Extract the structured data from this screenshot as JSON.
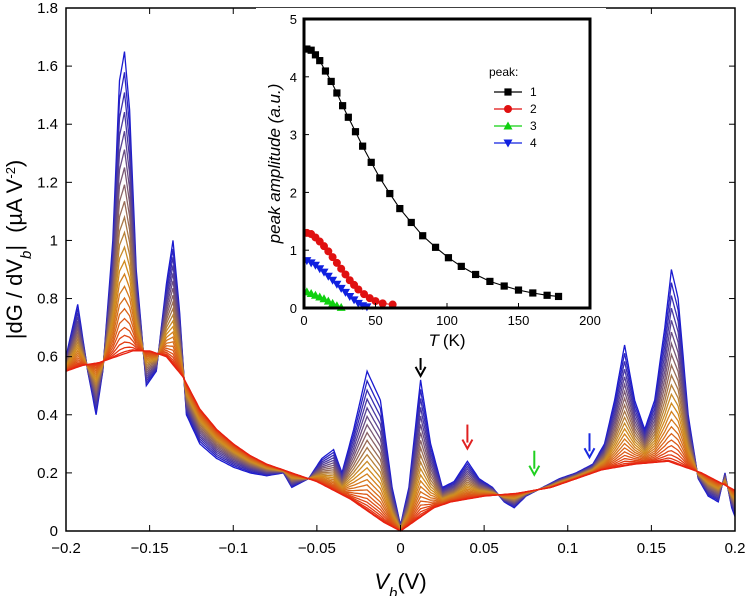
{
  "chart_data": [
    {
      "type": "line",
      "title": "",
      "xlabel": "V_b (V)",
      "ylabel": "|dG / dV_b|   (µA V^-2)",
      "xlabel_parts": {
        "symbol": "V",
        "sub": "b",
        "unit": "(V)"
      },
      "ylabel_parts": {
        "prefix": "|dG / dV",
        "sub": "b",
        "suffix": "|",
        "unit_open": "(µA V",
        "unit_sup": "-2",
        "unit_close": ")"
      },
      "xlim": [
        -0.2,
        0.2
      ],
      "ylim": [
        0,
        1.8
      ],
      "xticks": [
        -0.2,
        -0.15,
        -0.1,
        -0.05,
        0,
        0.05,
        0.1,
        0.15,
        0.2
      ],
      "xtick_labels": [
        "−0.2",
        "−0.15",
        "−0.1",
        "−0.05",
        "0",
        "0.05",
        "0.1",
        "0.15",
        "0.2"
      ],
      "yticks": [
        0,
        0.2,
        0.4,
        0.6,
        0.8,
        1,
        1.2,
        1.4,
        1.6,
        1.8
      ],
      "ytick_labels": [
        "0",
        "0.2",
        "0.4",
        "0.6",
        "0.8",
        "1",
        "1.2",
        "1.4",
        "1.6",
        "1.8"
      ],
      "grid": false,
      "series_note_colors": [
        "#1a1ad0",
        "#d09020",
        "#e82010"
      ],
      "n_curves": 24,
      "series": [
        {
          "temperature_order": "lowest",
          "x": [
            -0.2,
            -0.193,
            -0.187,
            -0.182,
            -0.178,
            -0.172,
            -0.168,
            -0.165,
            -0.162,
            -0.158,
            -0.152,
            -0.146,
            -0.14,
            -0.136,
            -0.132,
            -0.128,
            -0.12,
            -0.11,
            -0.1,
            -0.09,
            -0.08,
            -0.07,
            -0.065,
            -0.055,
            -0.047,
            -0.04,
            -0.035,
            -0.028,
            -0.02,
            -0.012,
            -0.005,
            0,
            0.005,
            0.012,
            0.018,
            0.025,
            0.032,
            0.04,
            0.047,
            0.055,
            0.062,
            0.068,
            0.075,
            0.085,
            0.095,
            0.105,
            0.115,
            0.122,
            0.128,
            0.134,
            0.14,
            0.146,
            0.152,
            0.158,
            0.162,
            0.166,
            0.172,
            0.178,
            0.184,
            0.19,
            0.194,
            0.198,
            0.2
          ],
          "y": [
            0.6,
            0.78,
            0.55,
            0.4,
            0.55,
            1.0,
            1.55,
            1.65,
            1.45,
            0.9,
            0.5,
            0.55,
            0.85,
            1.0,
            0.75,
            0.4,
            0.3,
            0.25,
            0.22,
            0.2,
            0.19,
            0.2,
            0.15,
            0.18,
            0.25,
            0.28,
            0.2,
            0.35,
            0.55,
            0.45,
            0.15,
            0.02,
            0.15,
            0.52,
            0.3,
            0.15,
            0.17,
            0.24,
            0.18,
            0.15,
            0.1,
            0.08,
            0.12,
            0.15,
            0.18,
            0.2,
            0.23,
            0.3,
            0.45,
            0.64,
            0.45,
            0.35,
            0.45,
            0.7,
            0.9,
            0.8,
            0.4,
            0.18,
            0.12,
            0.1,
            0.2,
            0.08,
            0.05
          ]
        },
        {
          "temperature_order": "highest",
          "x": [
            -0.2,
            -0.19,
            -0.18,
            -0.17,
            -0.16,
            -0.15,
            -0.14,
            -0.13,
            -0.12,
            -0.11,
            -0.1,
            -0.09,
            -0.08,
            -0.07,
            -0.06,
            -0.05,
            -0.04,
            -0.03,
            -0.02,
            -0.01,
            0,
            0.01,
            0.02,
            0.03,
            0.04,
            0.05,
            0.06,
            0.07,
            0.08,
            0.09,
            0.1,
            0.11,
            0.12,
            0.13,
            0.14,
            0.15,
            0.16,
            0.17,
            0.18,
            0.19,
            0.2
          ],
          "y": [
            0.55,
            0.57,
            0.58,
            0.6,
            0.62,
            0.62,
            0.6,
            0.53,
            0.42,
            0.35,
            0.3,
            0.26,
            0.23,
            0.21,
            0.19,
            0.17,
            0.14,
            0.11,
            0.07,
            0.03,
            0.0,
            0.04,
            0.08,
            0.1,
            0.11,
            0.12,
            0.125,
            0.13,
            0.14,
            0.15,
            0.17,
            0.19,
            0.21,
            0.22,
            0.23,
            0.235,
            0.24,
            0.22,
            0.2,
            0.17,
            0.14
          ]
        }
      ],
      "annotations": [
        {
          "type": "arrow",
          "x": 0.012,
          "y_tip": 0.52,
          "color": "#000000"
        },
        {
          "type": "arrow",
          "x": 0.04,
          "y_tip": 0.27,
          "color": "#e02020"
        },
        {
          "type": "arrow",
          "x": 0.08,
          "y_tip": 0.18,
          "color": "#20d020"
        },
        {
          "type": "arrow",
          "x": 0.113,
          "y_tip": 0.24,
          "color": "#1a2ae0"
        }
      ]
    },
    {
      "type": "line",
      "title": "",
      "xlabel": "T (K)",
      "ylabel": "peak amplitude (a.u.)",
      "xlabel_parts": {
        "symbol": "T",
        "unit": "(K)"
      },
      "xlim": [
        0,
        200
      ],
      "ylim": [
        0,
        5
      ],
      "xticks": [
        0,
        50,
        100,
        150,
        200
      ],
      "xtick_labels": [
        "0",
        "50",
        "100",
        "150",
        "200"
      ],
      "yticks": [
        0,
        1,
        2,
        3,
        4,
        5
      ],
      "ytick_labels": [
        "0",
        "1",
        "2",
        "3",
        "4",
        "5"
      ],
      "grid": false,
      "legend_title": "peak:",
      "legend_position": "top-right",
      "series": [
        {
          "name": "1",
          "color": "#000000",
          "marker": "square",
          "x": [
            2,
            5,
            8,
            11,
            15,
            19,
            23,
            27,
            31,
            36,
            41,
            47,
            53,
            60,
            67,
            75,
            83,
            92,
            101,
            110,
            120,
            130,
            140,
            150,
            160,
            170,
            178
          ],
          "y": [
            4.48,
            4.46,
            4.38,
            4.28,
            4.1,
            3.92,
            3.72,
            3.5,
            3.3,
            3.05,
            2.8,
            2.52,
            2.25,
            1.98,
            1.72,
            1.48,
            1.25,
            1.05,
            0.87,
            0.72,
            0.58,
            0.46,
            0.38,
            0.31,
            0.26,
            0.22,
            0.2
          ]
        },
        {
          "name": "2",
          "color": "#e01010",
          "marker": "circle",
          "x": [
            2,
            5,
            8,
            11,
            14,
            17,
            20,
            23,
            26,
            29,
            32,
            35,
            38,
            42,
            46,
            50,
            55,
            62
          ],
          "y": [
            1.3,
            1.28,
            1.22,
            1.15,
            1.07,
            0.98,
            0.88,
            0.78,
            0.68,
            0.58,
            0.48,
            0.4,
            0.32,
            0.24,
            0.17,
            0.12,
            0.08,
            0.06
          ]
        },
        {
          "name": "3",
          "color": "#10d010",
          "marker": "triangle-up",
          "x": [
            2,
            5,
            8,
            11,
            14,
            17,
            20,
            23,
            26
          ],
          "y": [
            0.28,
            0.25,
            0.22,
            0.19,
            0.16,
            0.12,
            0.08,
            0.04,
            0.01
          ]
        },
        {
          "name": "4",
          "color": "#1020e0",
          "marker": "triangle-down",
          "x": [
            2,
            5,
            8,
            11,
            14,
            17,
            20,
            23,
            26,
            29,
            32,
            35,
            38,
            41,
            44
          ],
          "y": [
            0.82,
            0.78,
            0.74,
            0.68,
            0.62,
            0.55,
            0.48,
            0.41,
            0.34,
            0.27,
            0.2,
            0.14,
            0.08,
            0.04,
            0.02
          ]
        }
      ]
    }
  ]
}
